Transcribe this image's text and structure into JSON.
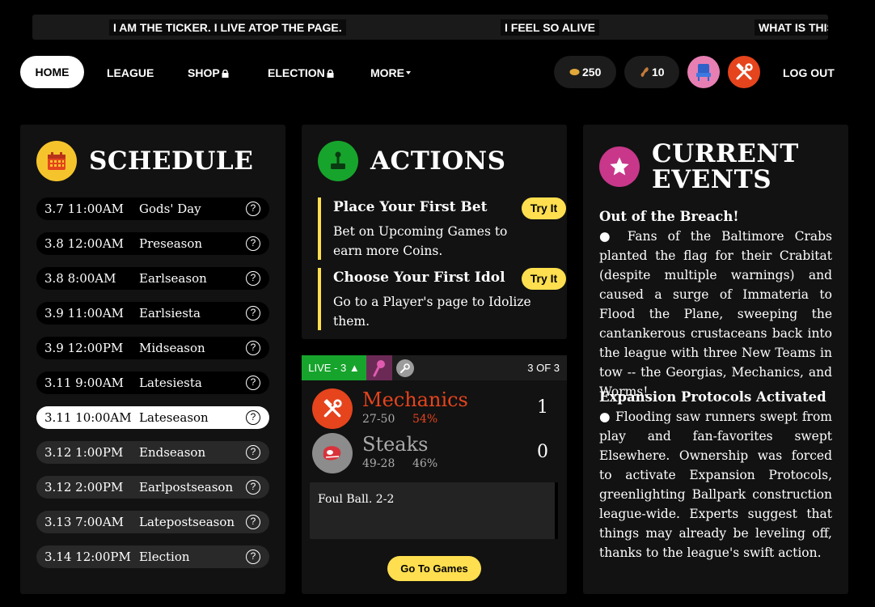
{
  "ticker": {
    "items": [
      "I AM THE TICKER. I LIVE ATOP THE PAGE.",
      "I FEEL SO ALIVE",
      "WHAT IS THIS"
    ]
  },
  "nav": {
    "home": "HOME",
    "league": "LEAGUE",
    "shop": "SHOP",
    "election": "ELECTION",
    "more": "MORE",
    "coins": "250",
    "votes": "10",
    "logout": "LOG OUT"
  },
  "colors": {
    "accent_yellow": "#ffdf4f",
    "live_green": "#17a42c",
    "mechanics_orange": "#e5441d",
    "steaks_gray": "#8c8c8c",
    "events_pink": "#c8378a",
    "actions_green": "#17a42c",
    "schedule_yellow": "#f5c42c"
  },
  "schedule": {
    "title": "SCHEDULE",
    "icon": "calendar-icon",
    "rows": [
      {
        "date": "3.7 11:00AM",
        "name": "Gods' Day",
        "state": "upcoming"
      },
      {
        "date": "3.8 12:00AM",
        "name": "Preseason",
        "state": "upcoming"
      },
      {
        "date": "3.8 8:00AM",
        "name": "Earlseason",
        "state": "upcoming"
      },
      {
        "date": "3.9 11:00AM",
        "name": "Earlsiesta",
        "state": "upcoming"
      },
      {
        "date": "3.9 12:00PM",
        "name": "Midseason",
        "state": "upcoming"
      },
      {
        "date": "3.11 9:00AM",
        "name": "Latesiesta",
        "state": "upcoming"
      },
      {
        "date": "3.11 10:00AM",
        "name": "Lateseason",
        "state": "current"
      },
      {
        "date": "3.12 1:00PM",
        "name": "Endseason",
        "state": "past"
      },
      {
        "date": "3.12 2:00PM",
        "name": "Earlpostseason",
        "state": "past"
      },
      {
        "date": "3.13 7:00AM",
        "name": "Latepostseason",
        "state": "past"
      },
      {
        "date": "3.14 12:00PM",
        "name": "Election",
        "state": "past"
      }
    ],
    "help_glyph": "?"
  },
  "actions": {
    "title": "ACTIONS",
    "icon": "joystick-icon",
    "items": [
      {
        "title": "Place Your First Bet",
        "desc": "Bet on Upcoming Games to earn more Coins.",
        "button": "Try It"
      },
      {
        "title": "Choose Your First Idol",
        "desc": "Go to a Player's page to Idolize them.",
        "button": "Try It"
      }
    ]
  },
  "game": {
    "live": "LIVE - 3 ▲",
    "inning": "3 OF 3",
    "home": {
      "name": "Mechanics",
      "record": "27-50",
      "pct": "54%",
      "score": "1",
      "icon": "wrench-hammer-icon"
    },
    "away": {
      "name": "Steaks",
      "record": "49-28",
      "pct": "46%",
      "score": "0",
      "icon": "steak-icon"
    },
    "last_play": "Foul Ball. 2-2",
    "button": "Go To Games"
  },
  "events": {
    "title_line1": "CURRENT",
    "title_line2": "EVENTS",
    "icon": "star-icon",
    "items": [
      {
        "heading": "Out of the Breach!",
        "body": "● Fans of the Baltimore Crabs planted the flag for their Crabitat (despite multiple warnings) and caused a surge of Immateria to Flood the Plane, sweeping the cantankerous crustaceans back into the league with three New Teams in tow -- the Georgias, Mechanics, and Worms!"
      },
      {
        "heading": "Expansion Protocols Activated",
        "body": "● Flooding saw runners swept from play and fan-favorites swept Elsewhere. Ownership was forced to activate Expansion Protocols, greenlighting Ballpark construction league-wide. Experts suggest that things may already be leveling off, thanks to the league's swift action."
      }
    ]
  }
}
